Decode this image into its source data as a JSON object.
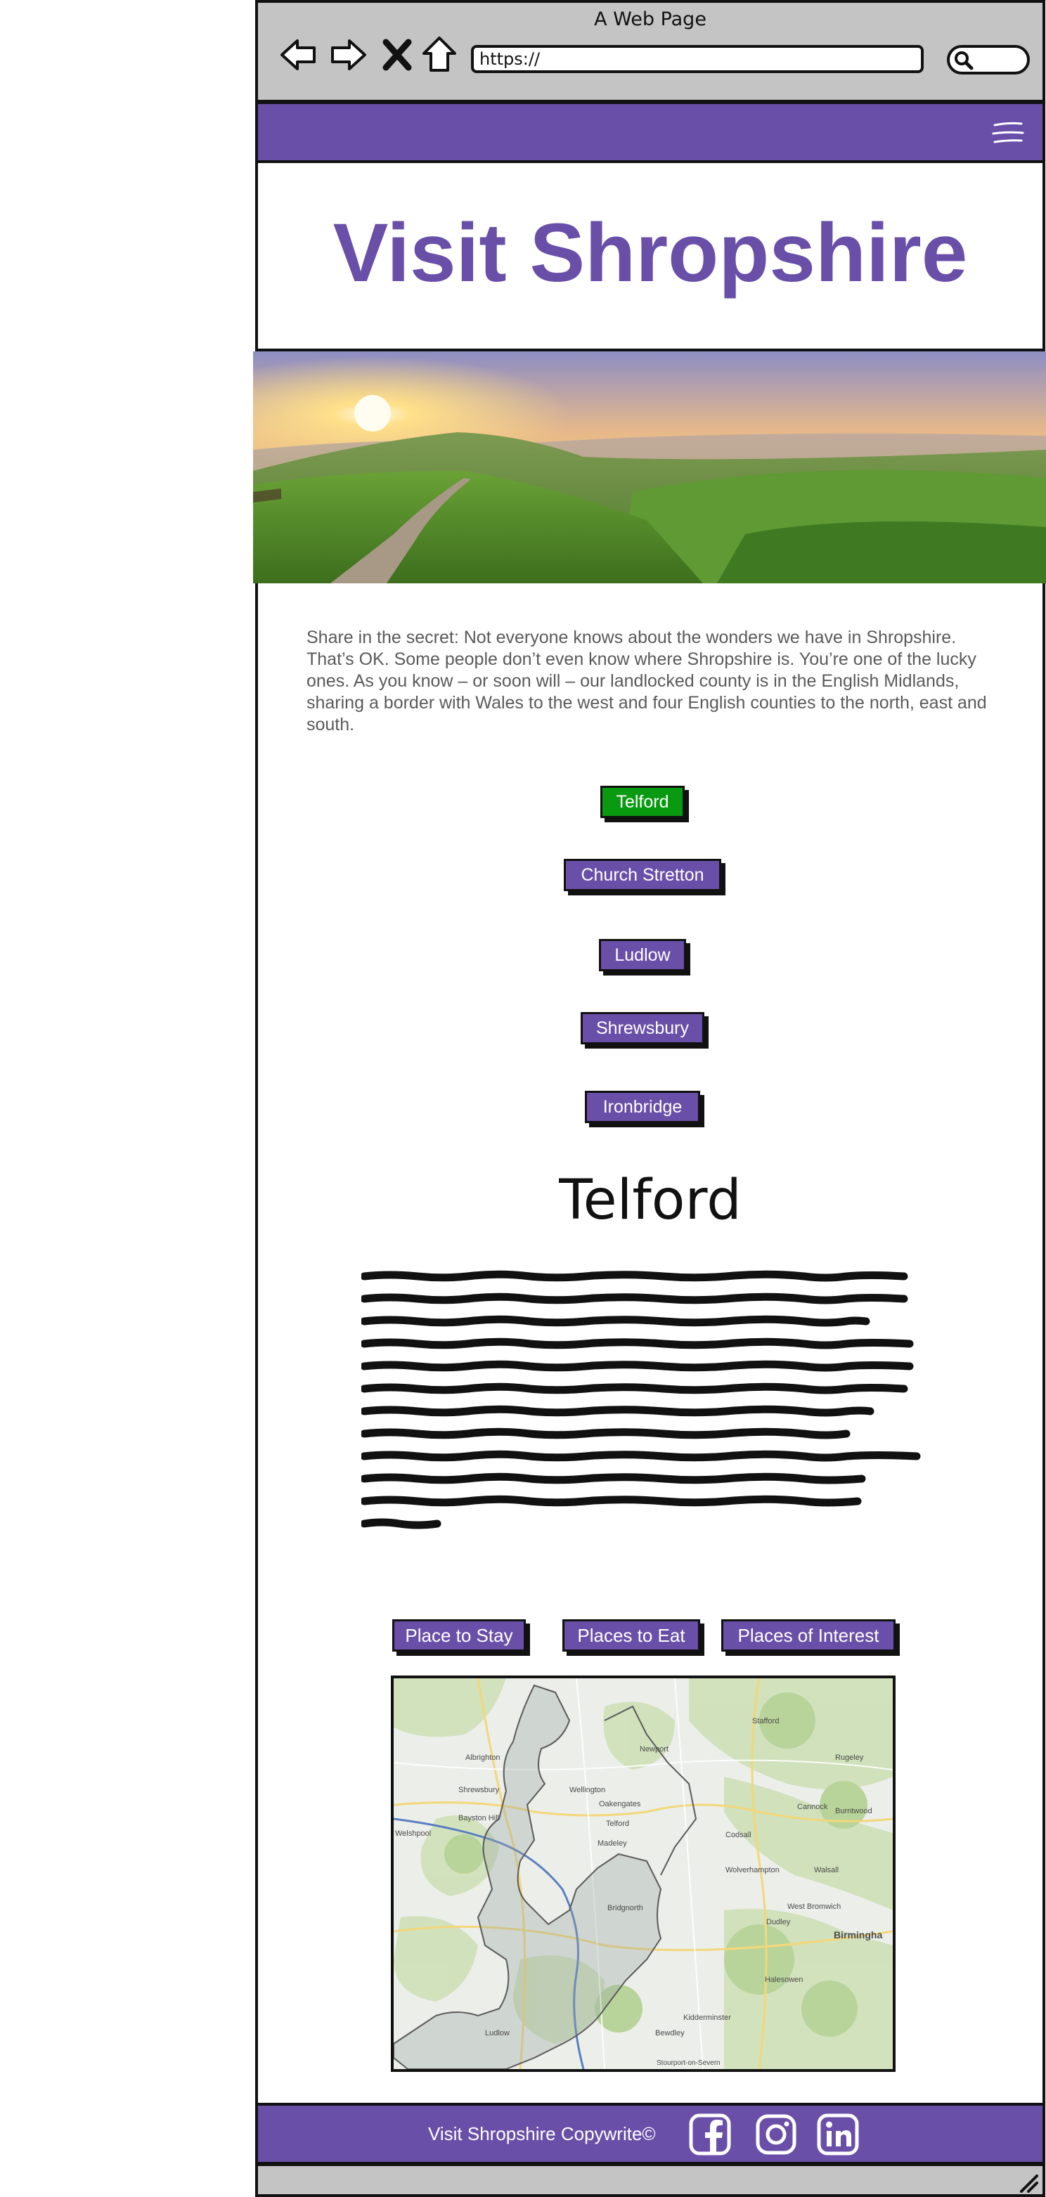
{
  "window": {
    "title": "A Web Page",
    "url": "https://"
  },
  "icons": {
    "back": "back-arrow-icon",
    "forward": "forward-arrow-icon",
    "close": "close-icon",
    "home": "home-icon",
    "search": "search-icon",
    "menu": "hamburger-menu-icon",
    "facebook": "facebook-icon",
    "instagram": "instagram-icon",
    "linkedin": "linkedin-icon",
    "resize": "resize-handle-icon"
  },
  "colors": {
    "brand": "#6a4fa8",
    "active": "#0a9a12",
    "chrome": "#c4c4c4",
    "text_muted": "#5a5a5a"
  },
  "header": {
    "title": "Visit Shropshire"
  },
  "intro": "Share in the secret: Not everyone knows about the wonders we have in Shropshire. That’s OK. Some people don’t even know where Shropshire is. You’re one of the lucky ones. As you know – or soon will – our landlocked county is in the English Midlands, sharing a border with Wales to the west and four English counties to the north, east and south.",
  "towns": [
    {
      "label": "Telford",
      "active": true
    },
    {
      "label": "Church Stretton",
      "active": false
    },
    {
      "label": "Ludlow",
      "active": false
    },
    {
      "label": "Shrewsbury",
      "active": false
    },
    {
      "label": "Ironbridge",
      "active": false
    }
  ],
  "selected_town": {
    "title": "Telford"
  },
  "categories": [
    {
      "label": "Place to Stay"
    },
    {
      "label": "Places to Eat"
    },
    {
      "label": "Places of Interest"
    }
  ],
  "map": {
    "labels": [
      "Stafford",
      "Newport",
      "Wellington",
      "Telford",
      "Shrewsbury",
      "Codsall",
      "Wolverhampton",
      "Walsall",
      "West Bromwich",
      "Dudley",
      "Birmingha",
      "Bridgnorth",
      "Kidderminster",
      "Bewdley",
      "Ludlow",
      "Stourport-on-Severn",
      "Madeley",
      "Oakengates",
      "Cannock",
      "Burntwood",
      "Rugeley",
      "Halesowen",
      "Welshpool",
      "Bayston Hill",
      "Albrighton"
    ]
  },
  "footer": {
    "text": "Visit Shropshire Copywrite©"
  }
}
